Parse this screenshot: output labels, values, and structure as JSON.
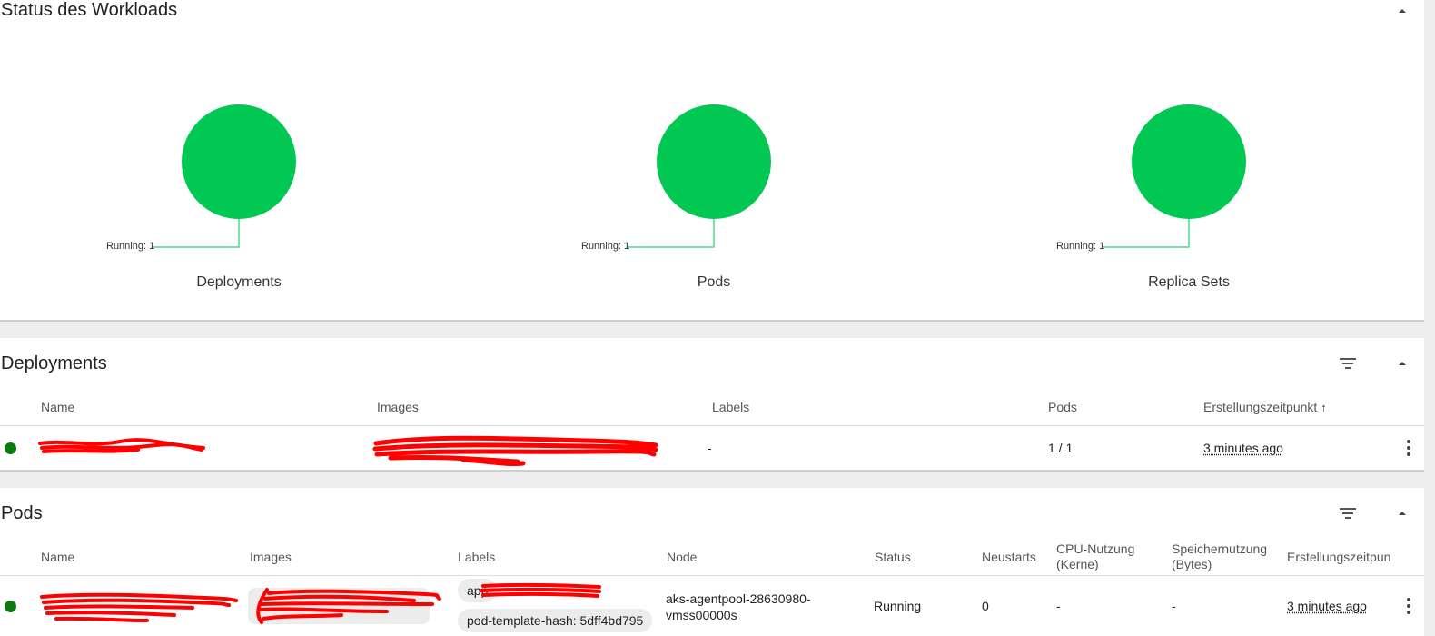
{
  "workload_status": {
    "title": "Status des Workloads",
    "charts": [
      {
        "name": "Deployments",
        "running_label": "Running: 1",
        "running": 1
      },
      {
        "name": "Pods",
        "running_label": "Running: 1",
        "running": 1
      },
      {
        "name": "Replica Sets",
        "running_label": "Running: 1",
        "running": 1
      }
    ],
    "colors": {
      "running": "#00c853",
      "leader": "#4ddb8a"
    }
  },
  "deployments": {
    "title": "Deployments",
    "columns": {
      "name": "Name",
      "images": "Images",
      "labels": "Labels",
      "pods": "Pods",
      "created": "Erstellungszeitpunkt"
    },
    "rows": [
      {
        "labels": "-",
        "pods": "1 / 1",
        "created": "3 minutes ago"
      }
    ]
  },
  "pods": {
    "title": "Pods",
    "columns": {
      "name": "Name",
      "images": "Images",
      "labels": "Labels",
      "node": "Node",
      "status": "Status",
      "restarts": "Neustarts",
      "cpu": "CPU-Nutzung (Kerne)",
      "memory": "Speichernutzung (Bytes)",
      "created": "Erstellungszeitpun"
    },
    "rows": [
      {
        "label_app": "app",
        "label_hash": "pod-template-hash: 5dff4bd795",
        "node": "aks-agentpool-28630980-vmss00000s",
        "status": "Running",
        "restarts": "0",
        "cpu": "-",
        "memory": "-",
        "created": "3 minutes ago"
      }
    ]
  },
  "icons": {
    "collapse": "chevron-up-icon",
    "filter": "filter-icon",
    "more": "more-vert-icon",
    "sort": "arrow-up-icon"
  },
  "colors": {
    "status_ok": "#0c7a0c",
    "redaction": "#ff0000"
  }
}
